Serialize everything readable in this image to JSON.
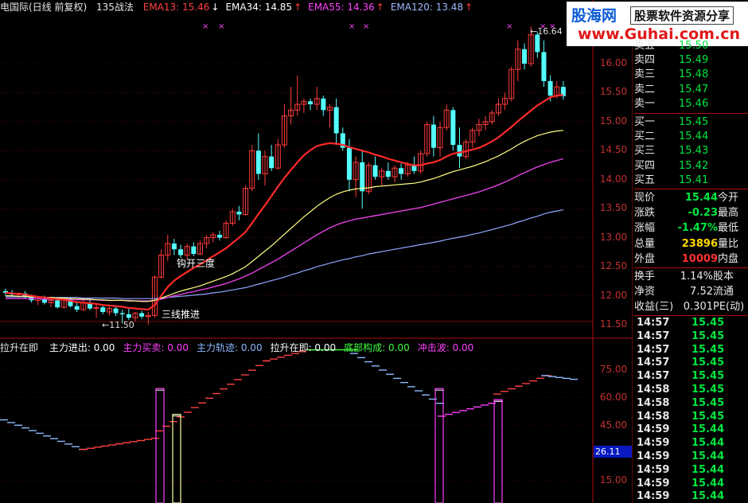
{
  "header": {
    "title": "电国际(日线 前复权)",
    "strategy": "135战法",
    "ema": [
      {
        "label": "EMA13: 15.46",
        "arrow": "↓",
        "color": "#ff4040"
      },
      {
        "label": "EMA34: 14.85",
        "arrow": "↑",
        "color": "#ffffff"
      },
      {
        "label": "EMA55: 14.36",
        "arrow": "↑",
        "color": "#ff40ff"
      },
      {
        "label": "EMA120: 13.48",
        "arrow": "↑",
        "color": "#9fb8ff"
      }
    ]
  },
  "indicator_header": {
    "name": "拉升在即",
    "items": [
      {
        "label": "主力进出: 0.00",
        "color": "#ffffff"
      },
      {
        "label": "主力买卖: 0.00",
        "color": "#ff40ff"
      },
      {
        "label": "主力轨迹: 0.00",
        "color": "#8fb8ff"
      },
      {
        "label": "拉升在即: 0.00",
        "color": "#ffffff"
      },
      {
        "label": "底部构成: 0.00",
        "color": "#40ff40"
      },
      {
        "label": "冲击波: 0.00",
        "color": "#ff40ff"
      }
    ]
  },
  "annotations": {
    "high": "16.64",
    "low": "11.50",
    "signal1": "钩开三度",
    "signal2": "三线推进"
  },
  "y_axis_main": [
    "16.00",
    "15.50",
    "15.00",
    "14.50",
    "14.00",
    "13.50",
    "13.00",
    "12.50",
    "12.00",
    "11.50"
  ],
  "y_axis_sub": [
    "75.00",
    "60.00",
    "45.00",
    "15.00"
  ],
  "sub_current": "26.11",
  "logo": {
    "cn": "股海网",
    "tagline": "股票软件资源分享",
    "url": "www.Guhai.com.cn"
  },
  "order_book": {
    "asks": [
      {
        "label": "卖五",
        "price": "15.50"
      },
      {
        "label": "卖四",
        "price": "15.49"
      },
      {
        "label": "卖三",
        "price": "15.48"
      },
      {
        "label": "卖二",
        "price": "15.47"
      },
      {
        "label": "卖一",
        "price": "15.46"
      }
    ],
    "bids": [
      {
        "label": "买一",
        "price": "15.45"
      },
      {
        "label": "买二",
        "price": "15.44"
      },
      {
        "label": "买三",
        "price": "15.43"
      },
      {
        "label": "买四",
        "price": "15.42"
      },
      {
        "label": "买五",
        "price": "15.41"
      }
    ]
  },
  "quote": [
    {
      "label": "现价",
      "value": "15.44",
      "value_color": "#00e640",
      "right": "今开"
    },
    {
      "label": "涨跌",
      "value": "-0.23",
      "value_color": "#00e640",
      "right": "最高"
    },
    {
      "label": "涨幅",
      "value": "-1.47%",
      "value_color": "#00e640",
      "right": "最低"
    },
    {
      "label": "总量",
      "value": "23896",
      "value_color": "#ffd700",
      "right": "量比"
    },
    {
      "label": "外盘",
      "value": "10009",
      "value_color": "#ff3030",
      "right": "内盘"
    }
  ],
  "stats": [
    {
      "label": "换手",
      "value": "1.14%",
      "right": "股本"
    },
    {
      "label": "净资",
      "value": "7.52",
      "right": "流通"
    },
    {
      "label": "收益(三)",
      "value": "0.301",
      "right": "PE(动)"
    }
  ],
  "ticks": [
    {
      "time": "14:57",
      "price": "15.45"
    },
    {
      "time": "14:57",
      "price": "15.45"
    },
    {
      "time": "14:57",
      "price": "15.45"
    },
    {
      "time": "14:57",
      "price": "15.45"
    },
    {
      "time": "14:57",
      "price": "15.45"
    },
    {
      "time": "14:58",
      "price": "15.45"
    },
    {
      "time": "14:58",
      "price": "15.45"
    },
    {
      "time": "14:58",
      "price": "15.45"
    },
    {
      "time": "14:59",
      "price": "15.44"
    },
    {
      "time": "14:59",
      "price": "15.44"
    },
    {
      "time": "14:59",
      "price": "15.44"
    },
    {
      "time": "14:59",
      "price": "15.44"
    },
    {
      "time": "14:59",
      "price": "15.44"
    },
    {
      "time": "14:59",
      "price": "15.44"
    }
  ],
  "colors": {
    "up": "#ff3b3b",
    "down": "#54ffff",
    "grid": "#8a1010",
    "ema13": "#ff2a2a",
    "ema34": "#ffff80",
    "ema55": "#e040e0",
    "ema120": "#8fa8ff"
  },
  "chart_data": {
    "type": "candlestick",
    "price_range": [
      11.3,
      16.8
    ],
    "candles": [
      [
        12.08,
        12.12,
        12.0,
        12.05
      ],
      [
        12.05,
        12.1,
        11.98,
        12.02
      ],
      [
        12.02,
        12.06,
        11.95,
        12.04
      ],
      [
        12.04,
        12.08,
        11.96,
        11.98
      ],
      [
        11.98,
        12.02,
        11.88,
        11.92
      ],
      [
        11.92,
        11.99,
        11.84,
        11.95
      ],
      [
        11.95,
        12.0,
        11.85,
        11.88
      ],
      [
        11.88,
        11.95,
        11.8,
        11.92
      ],
      [
        11.92,
        11.97,
        11.78,
        11.8
      ],
      [
        11.8,
        11.96,
        11.78,
        11.94
      ],
      [
        11.94,
        11.98,
        11.8,
        11.82
      ],
      [
        11.82,
        11.88,
        11.72,
        11.76
      ],
      [
        11.76,
        11.92,
        11.74,
        11.88
      ],
      [
        11.88,
        11.93,
        11.75,
        11.78
      ],
      [
        11.78,
        11.86,
        11.62,
        11.8
      ],
      [
        11.8,
        11.85,
        11.68,
        11.72
      ],
      [
        11.72,
        11.82,
        11.66,
        11.78
      ],
      [
        11.78,
        11.82,
        11.65,
        11.7
      ],
      [
        11.7,
        11.76,
        11.52,
        11.68
      ],
      [
        11.68,
        11.78,
        11.58,
        11.62
      ],
      [
        11.62,
        11.72,
        11.55,
        11.7
      ],
      [
        11.7,
        11.74,
        11.6,
        11.64
      ],
      [
        11.64,
        11.72,
        11.5,
        11.66
      ],
      [
        11.66,
        12.35,
        11.62,
        12.32
      ],
      [
        12.32,
        12.8,
        12.3,
        12.7
      ],
      [
        12.7,
        13.05,
        12.6,
        12.9
      ],
      [
        12.9,
        12.98,
        12.7,
        12.8
      ],
      [
        12.8,
        12.88,
        12.65,
        12.7
      ],
      [
        12.7,
        12.9,
        12.62,
        12.85
      ],
      [
        12.85,
        12.92,
        12.68,
        12.72
      ],
      [
        12.72,
        12.95,
        12.7,
        12.9
      ],
      [
        12.9,
        13.05,
        12.82,
        13.0
      ],
      [
        13.0,
        13.1,
        12.92,
        13.05
      ],
      [
        13.05,
        13.12,
        12.95,
        13.0
      ],
      [
        13.0,
        13.3,
        12.98,
        13.25
      ],
      [
        13.25,
        13.5,
        13.2,
        13.45
      ],
      [
        13.45,
        13.55,
        13.3,
        13.4
      ],
      [
        13.4,
        13.9,
        13.38,
        13.85
      ],
      [
        13.85,
        14.6,
        13.8,
        14.5
      ],
      [
        14.5,
        14.8,
        14.0,
        14.1
      ],
      [
        14.1,
        14.5,
        13.9,
        14.4
      ],
      [
        14.4,
        14.6,
        14.15,
        14.2
      ],
      [
        14.2,
        14.7,
        14.18,
        14.6
      ],
      [
        14.6,
        15.3,
        14.55,
        15.1
      ],
      [
        15.1,
        15.6,
        14.95,
        15.2
      ],
      [
        15.2,
        15.8,
        15.1,
        15.3
      ],
      [
        15.3,
        15.4,
        15.15,
        15.35
      ],
      [
        15.35,
        15.4,
        15.2,
        15.3
      ],
      [
        15.3,
        15.6,
        15.2,
        15.4
      ],
      [
        15.4,
        15.45,
        15.1,
        15.2
      ],
      [
        15.2,
        15.3,
        14.9,
        15.25
      ],
      [
        15.25,
        15.4,
        14.6,
        14.8
      ],
      [
        14.8,
        14.9,
        14.5,
        14.55
      ],
      [
        14.55,
        14.7,
        13.8,
        14.0
      ],
      [
        14.0,
        14.4,
        13.7,
        14.3
      ],
      [
        14.3,
        14.5,
        13.5,
        13.8
      ],
      [
        13.8,
        14.3,
        13.75,
        14.25
      ],
      [
        14.25,
        14.4,
        14.0,
        14.05
      ],
      [
        14.05,
        14.2,
        13.9,
        14.15
      ],
      [
        14.15,
        14.3,
        14.0,
        14.05
      ],
      [
        14.05,
        14.25,
        13.95,
        14.2
      ],
      [
        14.2,
        14.28,
        14.0,
        14.1
      ],
      [
        14.1,
        14.3,
        14.05,
        14.25
      ],
      [
        14.25,
        14.4,
        14.1,
        14.15
      ],
      [
        14.15,
        14.5,
        14.1,
        14.45
      ],
      [
        14.45,
        15.0,
        14.4,
        14.95
      ],
      [
        14.95,
        15.1,
        14.4,
        14.55
      ],
      [
        14.55,
        15.0,
        14.4,
        14.9
      ],
      [
        14.9,
        15.3,
        14.85,
        15.2
      ],
      [
        15.2,
        15.25,
        14.5,
        14.6
      ],
      [
        14.6,
        14.9,
        14.2,
        14.4
      ],
      [
        14.4,
        14.7,
        14.35,
        14.65
      ],
      [
        14.65,
        14.9,
        14.55,
        14.85
      ],
      [
        14.85,
        15.05,
        14.75,
        14.95
      ],
      [
        14.95,
        15.1,
        14.85,
        15.0
      ],
      [
        15.0,
        15.2,
        14.95,
        15.15
      ],
      [
        15.15,
        15.4,
        15.1,
        15.3
      ],
      [
        15.3,
        15.5,
        15.2,
        15.4
      ],
      [
        15.4,
        15.95,
        15.35,
        15.9
      ],
      [
        15.9,
        16.4,
        15.7,
        16.25
      ],
      [
        16.25,
        16.35,
        15.9,
        16.0
      ],
      [
        16.0,
        16.64,
        15.95,
        16.5
      ],
      [
        16.5,
        16.55,
        16.1,
        16.2
      ],
      [
        16.2,
        16.4,
        15.6,
        15.7
      ],
      [
        15.7,
        15.8,
        15.35,
        15.45
      ],
      [
        15.45,
        15.7,
        15.4,
        15.6
      ],
      [
        15.6,
        15.7,
        15.38,
        15.44
      ]
    ],
    "ema13": [
      12.05,
      12.04,
      12.03,
      12.02,
      12.0,
      11.98,
      11.97,
      11.95,
      11.94,
      11.93,
      11.91,
      11.89,
      11.88,
      11.87,
      11.86,
      11.84,
      11.83,
      11.82,
      11.81,
      11.79,
      11.78,
      11.77,
      11.76,
      11.84,
      12.0,
      12.15,
      12.26,
      12.34,
      12.41,
      12.48,
      12.54,
      12.61,
      12.68,
      12.75,
      12.82,
      12.91,
      13.0,
      13.1,
      13.25,
      13.41,
      13.56,
      13.72,
      13.88,
      14.03,
      14.17,
      14.3,
      14.42,
      14.51,
      14.58,
      14.61,
      14.63,
      14.62,
      14.6,
      14.56,
      14.53,
      14.5,
      14.47,
      14.43,
      14.4,
      14.36,
      14.33,
      14.3,
      14.27,
      14.25,
      14.25,
      14.28,
      14.3,
      14.34,
      14.4,
      14.45,
      14.47,
      14.49,
      14.52,
      14.55,
      14.6,
      14.66,
      14.73,
      14.82,
      14.91,
      15.01,
      15.1,
      15.19,
      15.28,
      15.35,
      15.42,
      15.45,
      15.46
    ],
    "ema34": [
      12.0,
      12.0,
      11.99,
      11.99,
      11.98,
      11.98,
      11.97,
      11.97,
      11.96,
      11.96,
      11.95,
      11.95,
      11.94,
      11.94,
      11.93,
      11.93,
      11.92,
      11.92,
      11.92,
      11.91,
      11.91,
      11.9,
      11.9,
      11.92,
      11.96,
      12.0,
      12.04,
      12.08,
      12.11,
      12.14,
      12.17,
      12.21,
      12.25,
      12.29,
      12.33,
      12.38,
      12.44,
      12.5,
      12.59,
      12.68,
      12.77,
      12.86,
      12.96,
      13.06,
      13.16,
      13.26,
      13.36,
      13.45,
      13.54,
      13.62,
      13.69,
      13.75,
      13.79,
      13.82,
      13.84,
      13.85,
      13.86,
      13.88,
      13.89,
      13.9,
      13.91,
      13.92,
      13.93,
      13.94,
      13.96,
      13.99,
      14.02,
      14.06,
      14.1,
      14.14,
      14.17,
      14.2,
      14.23,
      14.27,
      14.31,
      14.36,
      14.41,
      14.47,
      14.53,
      14.6,
      14.66,
      14.71,
      14.76,
      14.79,
      14.82,
      14.84,
      14.85
    ],
    "ema55": [
      11.95,
      11.95,
      11.95,
      11.95,
      11.95,
      11.95,
      11.94,
      11.94,
      11.94,
      11.94,
      11.94,
      11.93,
      11.93,
      11.93,
      11.93,
      11.92,
      11.92,
      11.92,
      11.92,
      11.92,
      11.91,
      11.91,
      11.91,
      11.92,
      11.94,
      11.97,
      12.0,
      12.02,
      12.05,
      12.07,
      12.1,
      12.12,
      12.15,
      12.18,
      12.21,
      12.25,
      12.29,
      12.34,
      12.39,
      12.45,
      12.51,
      12.57,
      12.63,
      12.7,
      12.77,
      12.84,
      12.91,
      12.98,
      13.05,
      13.11,
      13.17,
      13.22,
      13.26,
      13.29,
      13.32,
      13.34,
      13.36,
      13.38,
      13.4,
      13.42,
      13.44,
      13.46,
      13.48,
      13.5,
      13.52,
      13.55,
      13.58,
      13.61,
      13.64,
      13.67,
      13.7,
      13.73,
      13.76,
      13.79,
      13.83,
      13.87,
      13.91,
      13.96,
      14.01,
      14.07,
      14.12,
      14.17,
      14.22,
      14.26,
      14.3,
      14.33,
      14.36
    ],
    "ema120": [
      11.98,
      11.98,
      11.98,
      11.98,
      11.98,
      11.98,
      11.97,
      11.97,
      11.97,
      11.97,
      11.97,
      11.97,
      11.96,
      11.96,
      11.96,
      11.96,
      11.96,
      11.96,
      11.95,
      11.95,
      11.95,
      11.95,
      11.95,
      11.95,
      11.96,
      11.97,
      11.98,
      11.99,
      12.0,
      12.01,
      12.02,
      12.03,
      12.05,
      12.06,
      12.08,
      12.1,
      12.12,
      12.14,
      12.17,
      12.2,
      12.23,
      12.26,
      12.29,
      12.32,
      12.36,
      12.39,
      12.43,
      12.46,
      12.5,
      12.53,
      12.56,
      12.59,
      12.62,
      12.64,
      12.67,
      12.69,
      12.72,
      12.74,
      12.76,
      12.78,
      12.8,
      12.82,
      12.84,
      12.86,
      12.88,
      12.9,
      12.92,
      12.94,
      12.97,
      12.99,
      13.01,
      13.03,
      13.06,
      13.08,
      13.11,
      13.14,
      13.17,
      13.2,
      13.23,
      13.27,
      13.3,
      13.34,
      13.37,
      13.41,
      13.44,
      13.46,
      13.48
    ]
  }
}
